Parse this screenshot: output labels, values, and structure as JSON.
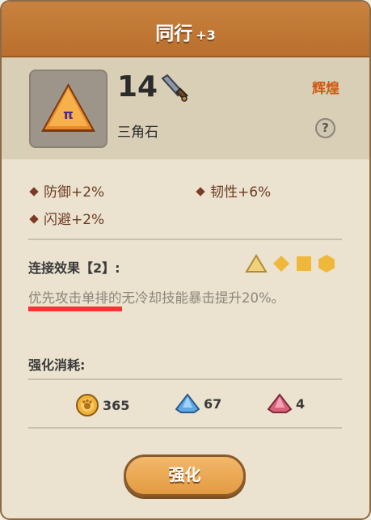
{
  "header": {
    "title": "同行",
    "plus": "+3"
  },
  "item": {
    "level": "14",
    "name": "三角石",
    "rarity": "辉煌",
    "help_label": "?"
  },
  "stats": [
    {
      "label": "防御+2%"
    },
    {
      "label": "韧性+6%"
    },
    {
      "label": "闪避+2%"
    }
  ],
  "link": {
    "title": "连接效果【2】:",
    "desc": "优先攻击单排的无冷却技能暴击提升20%。",
    "shapes": [
      "triangle-icon",
      "diamond-icon",
      "square-icon",
      "hexagon-icon"
    ]
  },
  "cost": {
    "title": "强化消耗:",
    "items": [
      {
        "icon": "coin-icon",
        "value": "365"
      },
      {
        "icon": "blue-crystal-icon",
        "value": "67"
      },
      {
        "icon": "red-crystal-icon",
        "value": "4"
      }
    ]
  },
  "button": {
    "label": "强化"
  },
  "colors": {
    "accent": "#c9823f",
    "stat_text": "#6c3a23",
    "rarity": "#d05a12"
  }
}
